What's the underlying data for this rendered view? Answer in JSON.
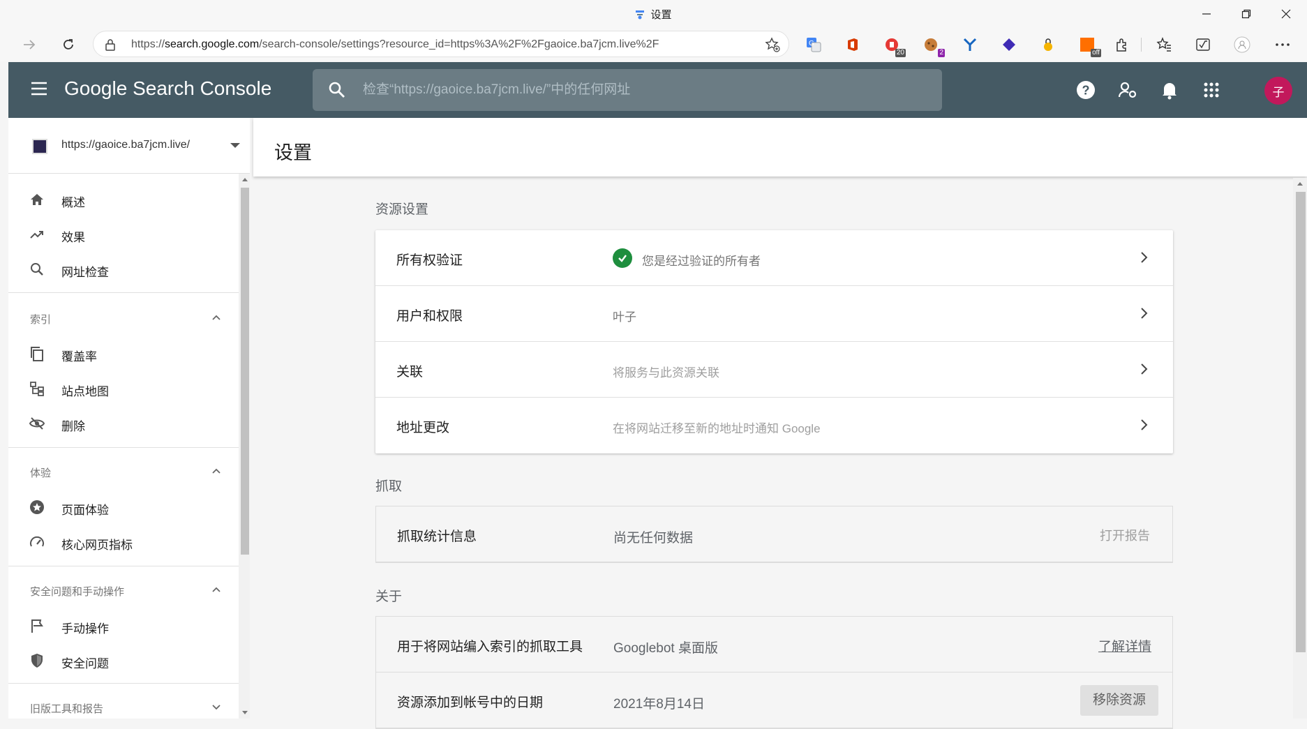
{
  "window": {
    "title": "设置",
    "controls": [
      "minimize",
      "restore",
      "close"
    ]
  },
  "browser": {
    "url_prefix": "https://",
    "url_host": "search.google.com",
    "url_path": "/search-console/settings?resource_id=https%3A%2F%2Fgaoice.ba7jcm.live%2F",
    "extensions": [
      {
        "name": "translate-icon",
        "badge": ""
      },
      {
        "name": "office-icon",
        "badge": ""
      },
      {
        "name": "adblock-icon",
        "badge": "20"
      },
      {
        "name": "cookie-icon",
        "badge": "2"
      },
      {
        "name": "y-icon",
        "badge": ""
      },
      {
        "name": "layers-icon",
        "badge": ""
      },
      {
        "name": "lock-ext-icon",
        "badge": ""
      },
      {
        "name": "off-ext-icon",
        "badge": "off"
      }
    ]
  },
  "app": {
    "brand": "Google Search Console",
    "search_placeholder": "检查“https://gaoice.ba7jcm.live/”中的任何网址",
    "avatar_letter": "子"
  },
  "sidebar": {
    "property": "https://gaoice.ba7jcm.live/",
    "top_items": [
      {
        "label": "概述",
        "icon": "home-icon"
      },
      {
        "label": "效果",
        "icon": "trending-up-icon"
      },
      {
        "label": "网址检查",
        "icon": "search-icon"
      }
    ],
    "sections": [
      {
        "title": "索引",
        "items": [
          {
            "label": "覆盖率",
            "icon": "copy-icon"
          },
          {
            "label": "站点地图",
            "icon": "sitemap-icon"
          },
          {
            "label": "删除",
            "icon": "eye-off-icon"
          }
        ]
      },
      {
        "title": "体验",
        "items": [
          {
            "label": "页面体验",
            "icon": "star-circle-icon"
          },
          {
            "label": "核心网页指标",
            "icon": "gauge-icon"
          }
        ]
      },
      {
        "title": "安全问题和手动操作",
        "items": [
          {
            "label": "手动操作",
            "icon": "flag-icon"
          },
          {
            "label": "安全问题",
            "icon": "shield-icon"
          }
        ]
      },
      {
        "title": "旧版工具和报告",
        "items": []
      }
    ]
  },
  "page": {
    "title": "设置",
    "resource_settings": {
      "title": "资源设置",
      "rows": [
        {
          "label": "所有权验证",
          "value": "您是经过验证的所有者"
        },
        {
          "label": "用户和权限",
          "value": "叶子"
        },
        {
          "label": "关联",
          "value": "将服务与此资源关联"
        },
        {
          "label": "地址更改",
          "value": "在将网站迁移至新的地址时通知 Google"
        }
      ]
    },
    "crawl": {
      "title": "抓取",
      "label": "抓取统计信息",
      "value": "尚无任何数据",
      "action": "打开报告"
    },
    "about": {
      "title": "关于",
      "rows": [
        {
          "label": "用于将网站编入索引的抓取工具",
          "value": "Googlebot 桌面版",
          "action": "了解详情"
        },
        {
          "label": "资源添加到帐号中的日期",
          "value": "2021年8月14日",
          "action": "移除资源"
        }
      ]
    }
  },
  "colors": {
    "appbar": "#455a64",
    "avatar": "#c2185b",
    "verified": "#1e8e3e"
  }
}
